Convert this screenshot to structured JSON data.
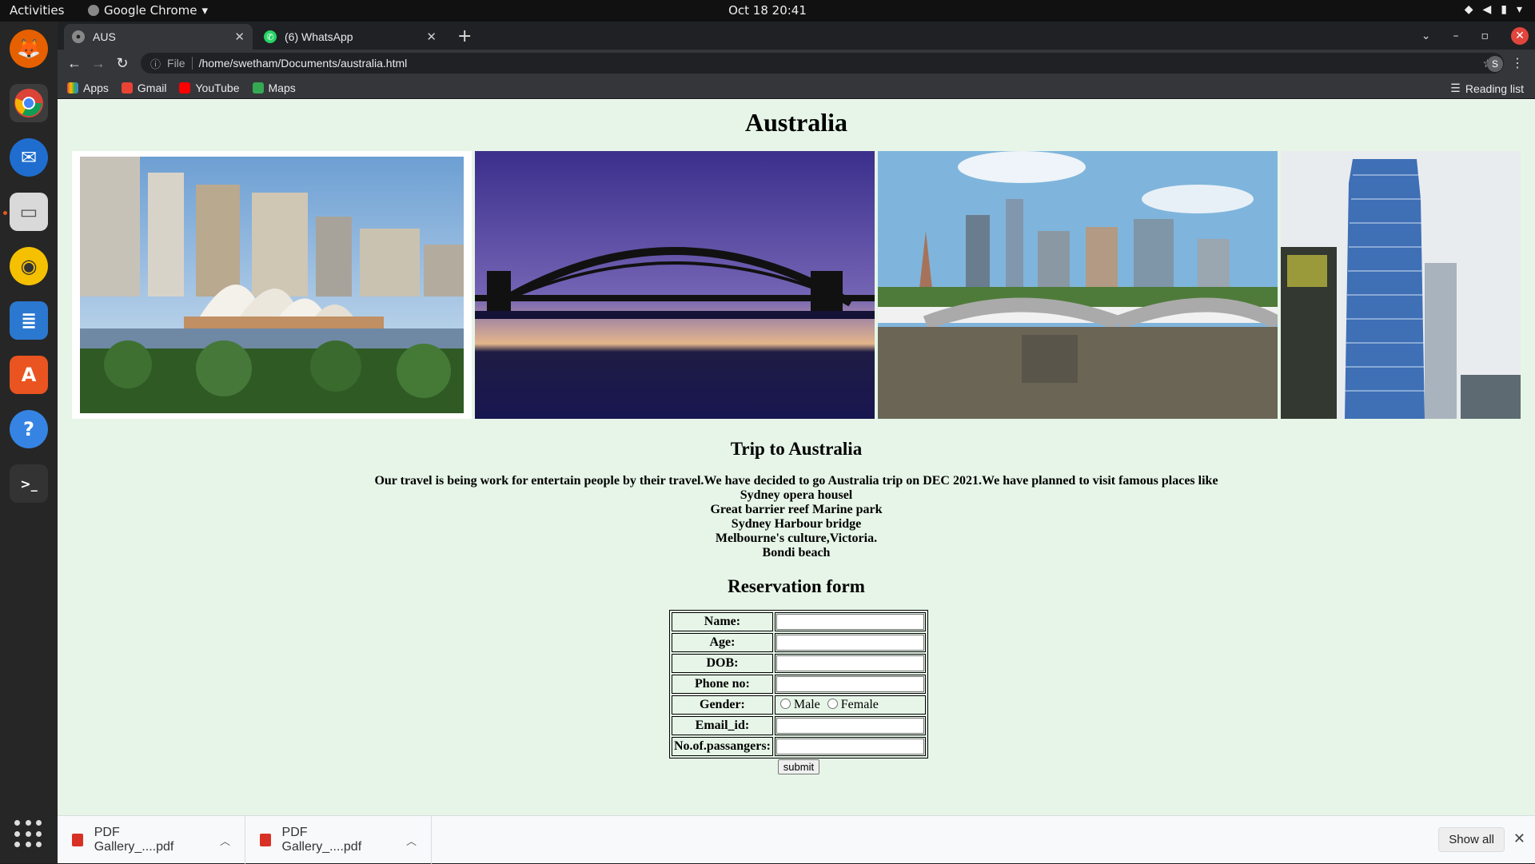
{
  "topbar": {
    "activities": "Activities",
    "app_name": "Google Chrome",
    "clock": "Oct 18  20:41"
  },
  "dock": {
    "apps": [
      "Firefox",
      "Google Chrome",
      "Thunderbird",
      "Files",
      "Rhythmbox",
      "LibreOffice Writer",
      "Ubuntu Software",
      "Help",
      "Terminal"
    ]
  },
  "browser": {
    "tabs": [
      {
        "title": "AUS",
        "active": true
      },
      {
        "title": "(6) WhatsApp",
        "active": false
      }
    ],
    "address": {
      "scheme_label": "File",
      "url": "/home/swetham/Documents/australia.html"
    },
    "profile_initial": "S",
    "bookmarks": [
      "Apps",
      "Gmail",
      "YouTube",
      "Maps"
    ],
    "reading_list": "Reading list"
  },
  "page": {
    "title": "Australia",
    "images": [
      {
        "icon": "sydney-opera-house-photo"
      },
      {
        "icon": "sydney-harbour-bridge-photo"
      },
      {
        "icon": "melbourne-bridge-photo"
      },
      {
        "icon": "skyscraper-photo"
      }
    ],
    "trip_heading": "Trip to Australia",
    "trip_intro": "Our travel is being work for entertain people by their travel.We have decided to go Australia trip on DEC 2021.We have planned to visit famous places like",
    "places": [
      "Sydney opera housel",
      "Great barrier reef Marine park",
      "Sydney Harbour bridge",
      "Melbourne's culture,Victoria.",
      "Bondi beach"
    ],
    "form_heading": "Reservation form",
    "form": {
      "name_label": "Name:",
      "age_label": "Age:",
      "dob_label": "DOB:",
      "phone_label": "Phone no:",
      "gender_label": "Gender:",
      "male_label": "Male",
      "female_label": "Female",
      "email_label": "Email_id:",
      "passengers_label": "No.of.passangers:",
      "submit_label": "submit"
    }
  },
  "downloads": {
    "items": [
      "PDF Gallery_....pdf",
      "PDF Gallery_....pdf"
    ],
    "show_all": "Show all"
  }
}
